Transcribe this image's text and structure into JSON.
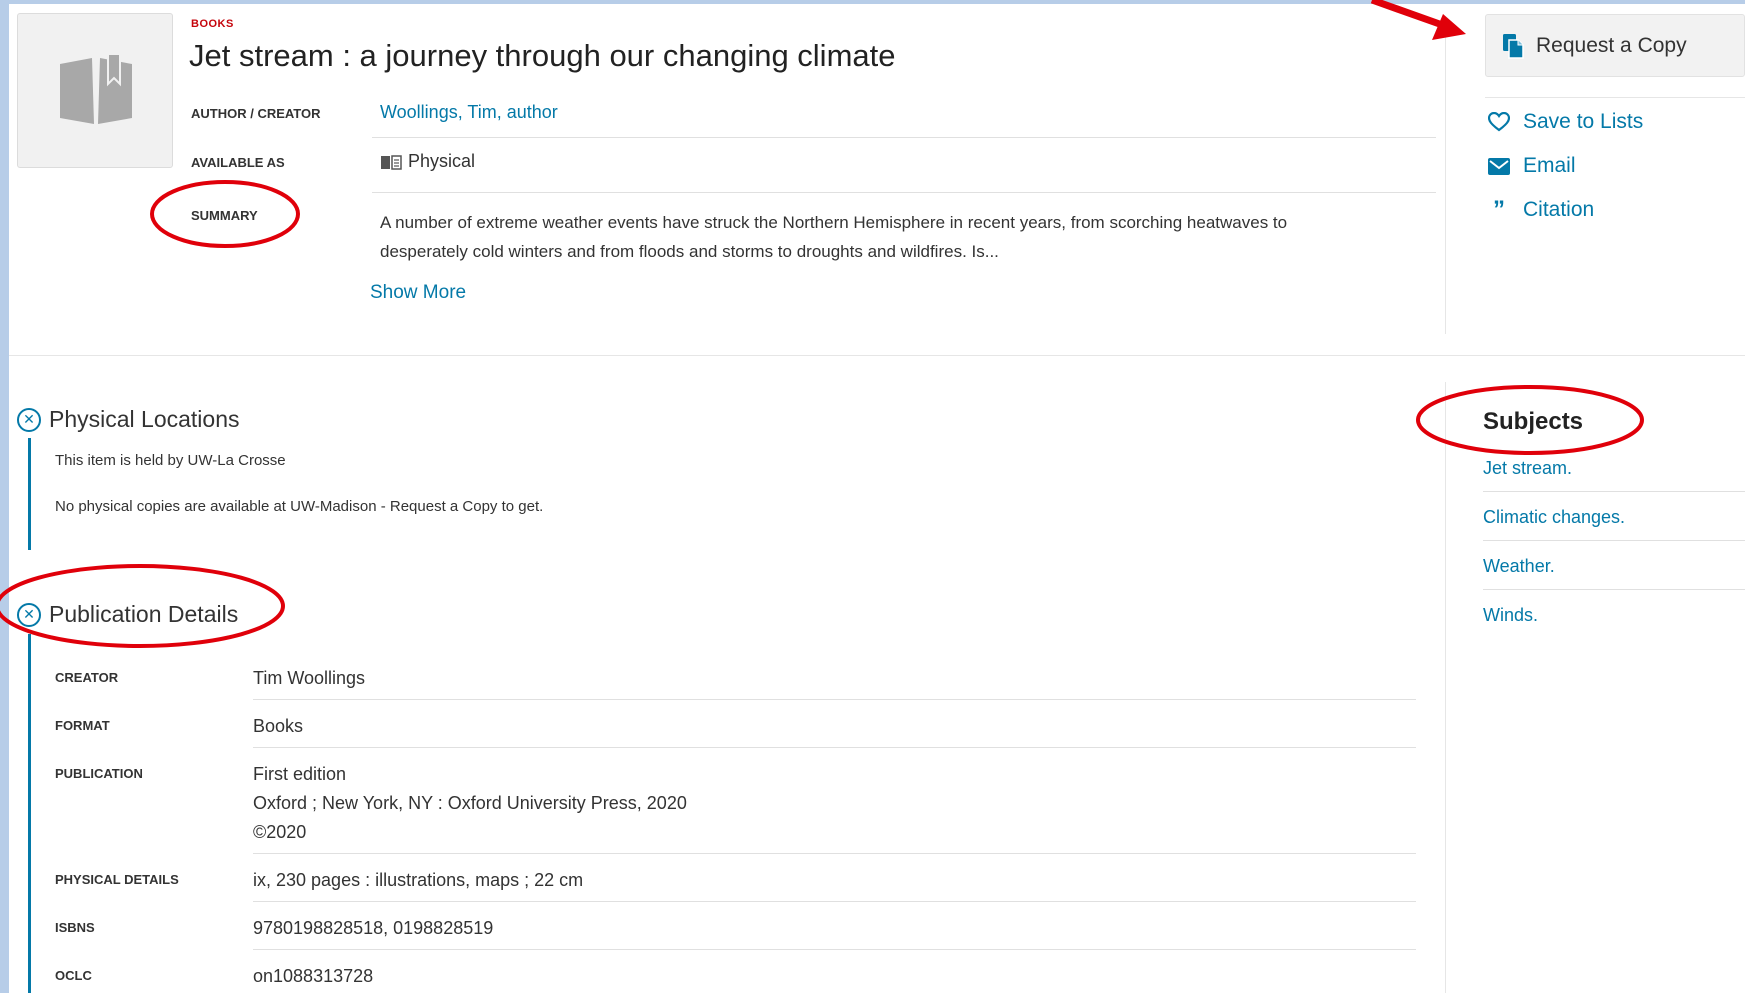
{
  "record": {
    "format_label": "BOOKS",
    "title": "Jet stream : a journey through our changing climate",
    "author_label": "AUTHOR / CREATOR",
    "author_value": "Woollings, Tim, author",
    "available_label": "AVAILABLE AS",
    "available_value": "Physical",
    "summary_label": "SUMMARY",
    "summary_line1": "A number of extreme weather events have struck the Northern Hemisphere in recent years, from scorching heatwaves to",
    "summary_line2": "desperately cold winters and from floods and storms to droughts and wildfires. Is...",
    "show_more": "Show More"
  },
  "actions": {
    "request_copy": "Request a Copy",
    "save_to_lists": "Save to Lists",
    "email": "Email",
    "citation": "Citation"
  },
  "physical_locations": {
    "heading": "Physical Locations",
    "held_by": "This item is held by UW-La Crosse",
    "availability": "No physical copies are available at UW-Madison - Request a Copy to get."
  },
  "publication_details": {
    "heading": "Publication Details",
    "rows": [
      {
        "label": "CREATOR",
        "value": "Tim Woollings"
      },
      {
        "label": "FORMAT",
        "value": "Books"
      },
      {
        "label": "PUBLICATION",
        "line1": "First edition",
        "line2": "Oxford ; New York, NY : Oxford University Press, 2020",
        "line3": "©2020"
      },
      {
        "label": "PHYSICAL DETAILS",
        "value": "ix, 230 pages : illustrations, maps ; 22 cm"
      },
      {
        "label": "ISBNS",
        "value": "9780198828518, 0198828519"
      },
      {
        "label": "OCLC",
        "value": "on1088313728"
      }
    ]
  },
  "subjects": {
    "heading": "Subjects",
    "items": [
      "Jet stream.",
      "Climatic changes.",
      "Weather.",
      "Winds."
    ]
  },
  "colors": {
    "link": "#0479a8",
    "format_label": "#c5050c",
    "annotation": "#e0000a",
    "page_background": "#b7cde8"
  }
}
